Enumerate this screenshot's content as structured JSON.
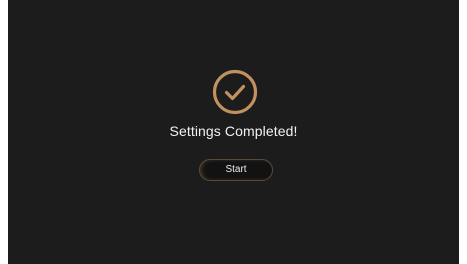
{
  "dialog": {
    "title": "Settings Completed!",
    "icon": "check-circle-icon",
    "accent_color": "#c1915f",
    "background_color": "#1c1c1c"
  },
  "actions": {
    "start_label": "Start"
  }
}
